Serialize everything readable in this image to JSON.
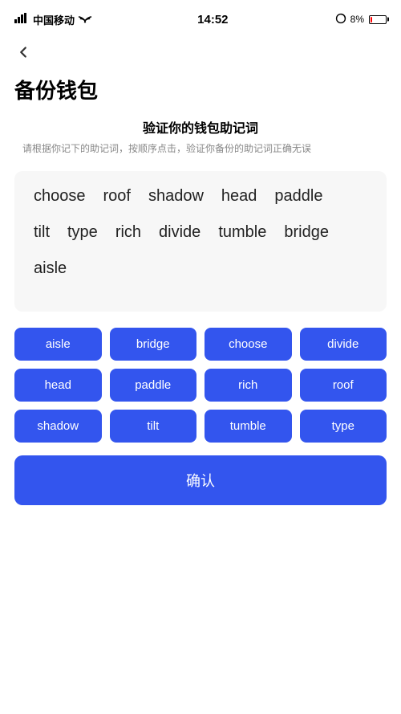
{
  "statusBar": {
    "carrier": "中国移动",
    "time": "14:52",
    "battery": "8%"
  },
  "page": {
    "title": "备份钱包",
    "sectionTitle": "验证你的钱包助记词",
    "sectionDesc": "请根据你记下的助记词，按顺序点击，验证你备份的助记词正确无误"
  },
  "displayWords": [
    "choose",
    "roof",
    "shadow",
    "head",
    "paddle",
    "tilt",
    "type",
    "rich",
    "divide",
    "tumble",
    "bridge",
    "aisle"
  ],
  "wordButtons": [
    "aisle",
    "bridge",
    "choose",
    "divide",
    "head",
    "paddle",
    "rich",
    "roof",
    "shadow",
    "tilt",
    "tumble",
    "type"
  ],
  "confirmLabel": "确认"
}
